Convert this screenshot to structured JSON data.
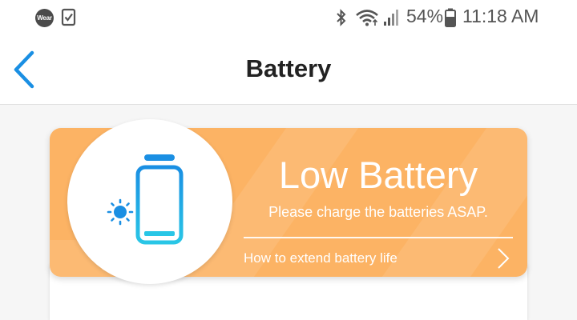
{
  "status_bar": {
    "wear_badge": "Wear",
    "battery_percent": "54%",
    "time": "11:18 AM",
    "icons": [
      "wear-app-icon",
      "checkbox-notification-icon",
      "bluetooth-icon",
      "wifi-icon",
      "signal-icon",
      "battery-icon"
    ]
  },
  "header": {
    "title": "Battery",
    "back_icon": "chevron-left-icon"
  },
  "card": {
    "title": "Low Battery",
    "subtitle": "Please charge the batteries ASAP.",
    "link_label": "How to extend battery life",
    "icons": [
      "low-battery-icon",
      "sun-icon",
      "chevron-right-icon"
    ]
  },
  "colors": {
    "accent_blue": "#1a8fe3",
    "card_orange": "#fcb364",
    "battery_cyan": "#29c6e6"
  }
}
